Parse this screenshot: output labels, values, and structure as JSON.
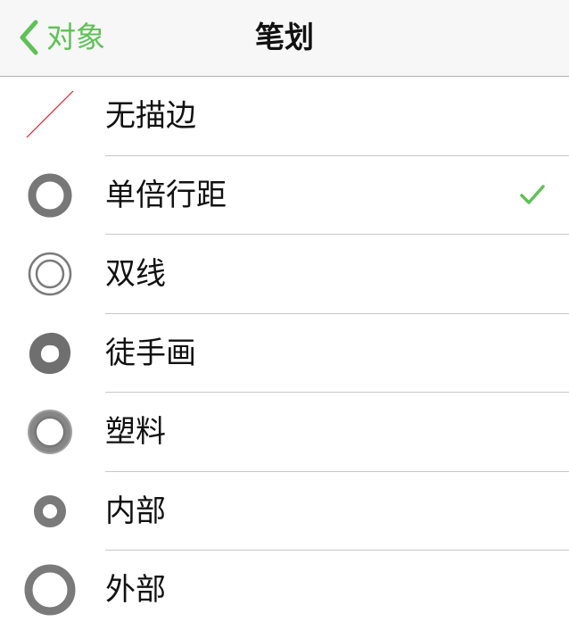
{
  "navbar": {
    "back_label": "对象",
    "title": "笔划"
  },
  "colors": {
    "accent": "#5fc156",
    "stroke_gray": "#7a7a7a",
    "no_stroke_red": "#e0202a"
  },
  "rows": [
    {
      "label": "无描边",
      "icon": "no-stroke-icon",
      "selected": false
    },
    {
      "label": "单倍行距",
      "icon": "single-ring-icon",
      "selected": true
    },
    {
      "label": "双线",
      "icon": "double-ring-icon",
      "selected": false
    },
    {
      "label": "徒手画",
      "icon": "freehand-ring-icon",
      "selected": false
    },
    {
      "label": "塑料",
      "icon": "plastic-ring-icon",
      "selected": false
    },
    {
      "label": "内部",
      "icon": "inner-ring-icon",
      "selected": false
    },
    {
      "label": "外部",
      "icon": "outer-ring-icon",
      "selected": false
    }
  ]
}
